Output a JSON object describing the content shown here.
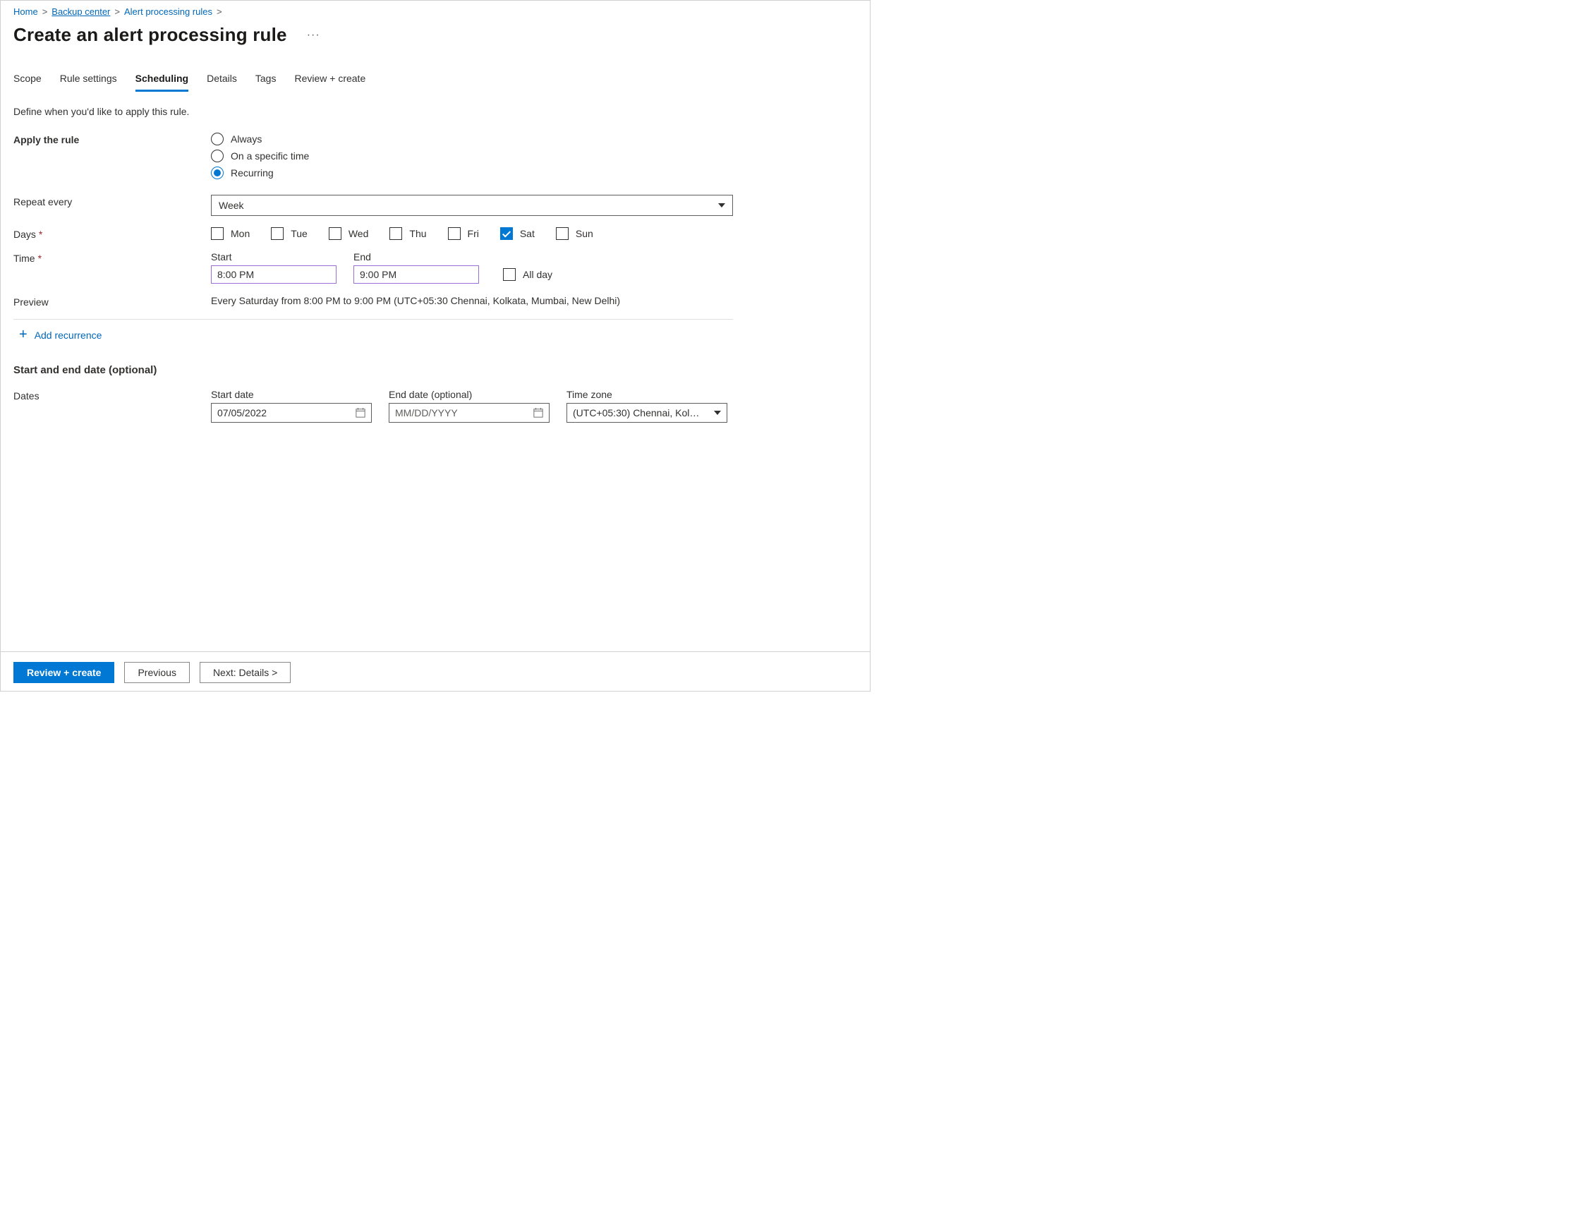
{
  "breadcrumb": {
    "home": "Home",
    "backup_center": "Backup center",
    "alert_processing_rules": "Alert processing rules"
  },
  "page_title": "Create an alert processing rule",
  "tabs": {
    "scope": "Scope",
    "rule_settings": "Rule settings",
    "scheduling": "Scheduling",
    "details": "Details",
    "tags": "Tags",
    "review_create": "Review + create"
  },
  "helper_text": "Define when you'd like to apply this rule.",
  "apply_rule": {
    "label": "Apply the rule",
    "options": {
      "always": "Always",
      "specific": "On a specific time",
      "recurring": "Recurring"
    },
    "selected": "recurring"
  },
  "repeat_every": {
    "label": "Repeat every",
    "value": "Week"
  },
  "days": {
    "label": "Days",
    "items": {
      "mon": {
        "label": "Mon",
        "checked": false
      },
      "tue": {
        "label": "Tue",
        "checked": false
      },
      "wed": {
        "label": "Wed",
        "checked": false
      },
      "thu": {
        "label": "Thu",
        "checked": false
      },
      "fri": {
        "label": "Fri",
        "checked": false
      },
      "sat": {
        "label": "Sat",
        "checked": true
      },
      "sun": {
        "label": "Sun",
        "checked": false
      }
    }
  },
  "time": {
    "label": "Time",
    "start_label": "Start",
    "start_value": "8:00 PM",
    "end_label": "End",
    "end_value": "9:00 PM",
    "all_day_label": "All day",
    "all_day_checked": false
  },
  "preview": {
    "label": "Preview",
    "text": "Every Saturday from 8:00 PM to 9:00 PM (UTC+05:30 Chennai, Kolkata, Mumbai, New Delhi)"
  },
  "add_recurrence": "Add recurrence",
  "start_end_header": "Start and end date (optional)",
  "dates_label": "Dates",
  "start_date": {
    "label": "Start date",
    "value": "07/05/2022"
  },
  "end_date": {
    "label": "End date (optional)",
    "placeholder": "MM/DD/YYYY"
  },
  "timezone": {
    "label": "Time zone",
    "value": "(UTC+05:30) Chennai, Kolka..."
  },
  "footer": {
    "review": "Review + create",
    "previous": "Previous",
    "next": "Next: Details >"
  }
}
